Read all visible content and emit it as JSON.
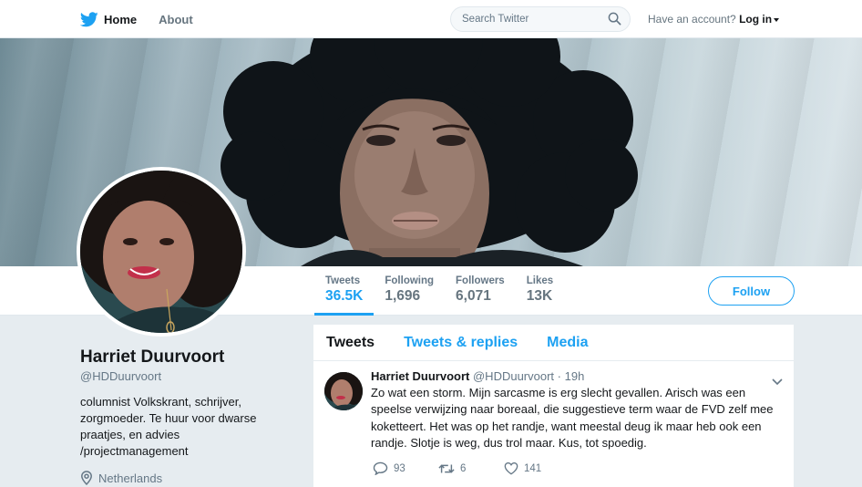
{
  "nav": {
    "home_label": "Home",
    "about_label": "About",
    "search_placeholder": "Search Twitter",
    "account_prompt": "Have an account?",
    "login_label": "Log in"
  },
  "profile": {
    "name": "Harriet Duurvoort",
    "handle": "@HDDuurvoort",
    "bio": "columnist Volkskrant, schrijver, zorgmoeder. Te huur voor dwarse praatjes, en advies /projectmanagement",
    "location": "Netherlands",
    "follow_label": "Follow"
  },
  "stats": [
    {
      "label": "Tweets",
      "value": "36.5K"
    },
    {
      "label": "Following",
      "value": "1,696"
    },
    {
      "label": "Followers",
      "value": "6,071"
    },
    {
      "label": "Likes",
      "value": "13K"
    }
  ],
  "tabs": [
    {
      "label": "Tweets"
    },
    {
      "label": "Tweets & replies"
    },
    {
      "label": "Media"
    }
  ],
  "tweet": {
    "name": "Harriet Duurvoort",
    "handle": "@HDDuurvoort",
    "time": "· 19h",
    "text": "Zo wat een storm. Mijn sarcasme is erg slecht gevallen. Arisch was een speelse verwijzing naar boreaal, die suggestieve term waar de FVD zelf mee koketteert. Het was op het randje, want meestal deug ik maar heb ook een randje. Slotje is weg, dus trol maar. Kus, tot spoedig.",
    "replies": "93",
    "retweets": "6",
    "likes": "141"
  },
  "colors": {
    "accent": "#1da1f2",
    "background": "#e6ecf0",
    "text": "#14171a",
    "muted": "#657786"
  }
}
